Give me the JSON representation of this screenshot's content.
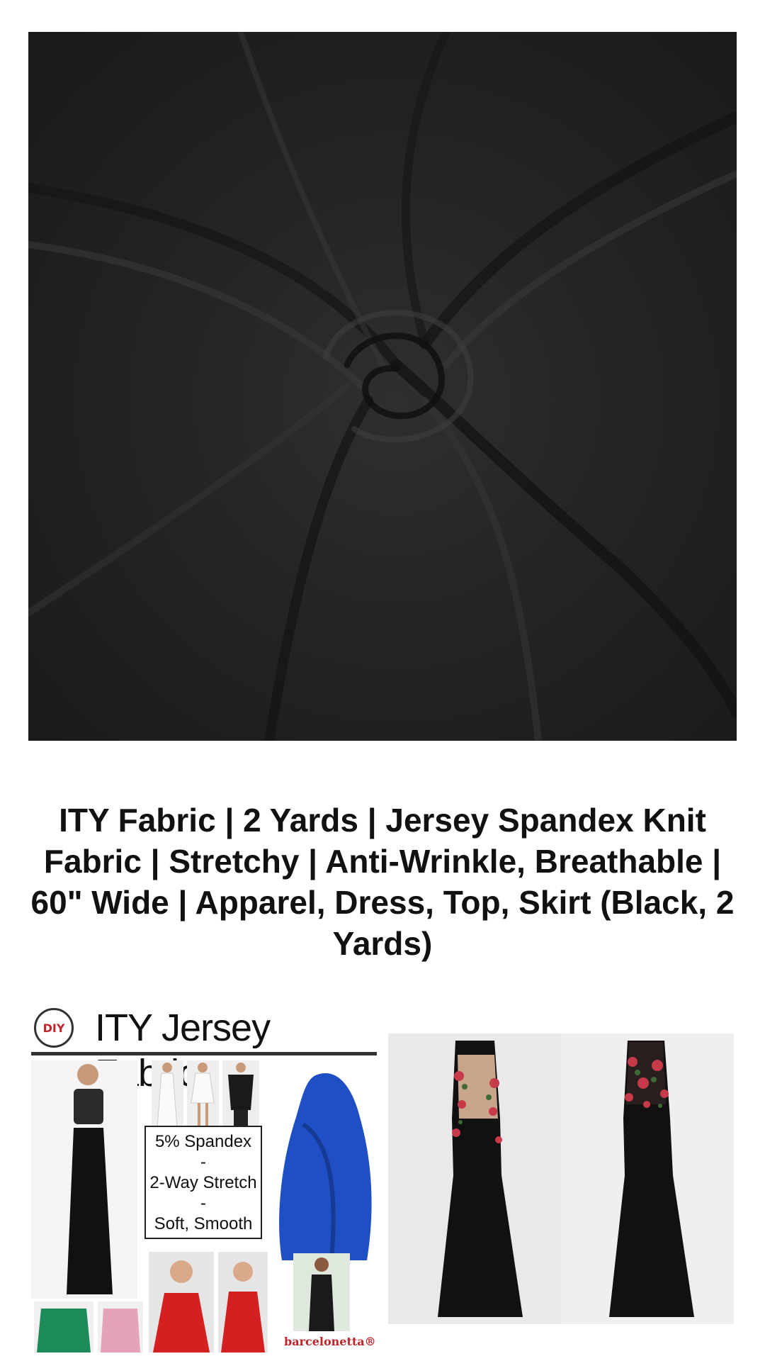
{
  "product": {
    "title": "ITY Fabric | 2 Yards | Jersey Spandex Knit Fabric | Stretchy | Anti-Wrinkle, Breathable | 60\" Wide | Apparel, Dress, Top, Skirt (Black, 2 Yards)",
    "main_image": {
      "color": "#222222"
    }
  },
  "infographic": {
    "logo_text": "DIY",
    "heading": "ITY Jersey Fabric",
    "spec_lines": [
      "5% Spandex",
      "-",
      "2-Way Stretch",
      "-",
      "Soft, Smooth"
    ],
    "brand": "barcelonetta®"
  },
  "colors": {
    "fabric": "#222222",
    "royal_blue": "#1f4fc4",
    "red": "#d42020",
    "green": "#1d8a5a",
    "pink": "#e4a3b8",
    "brand_red": "#c0232a"
  }
}
